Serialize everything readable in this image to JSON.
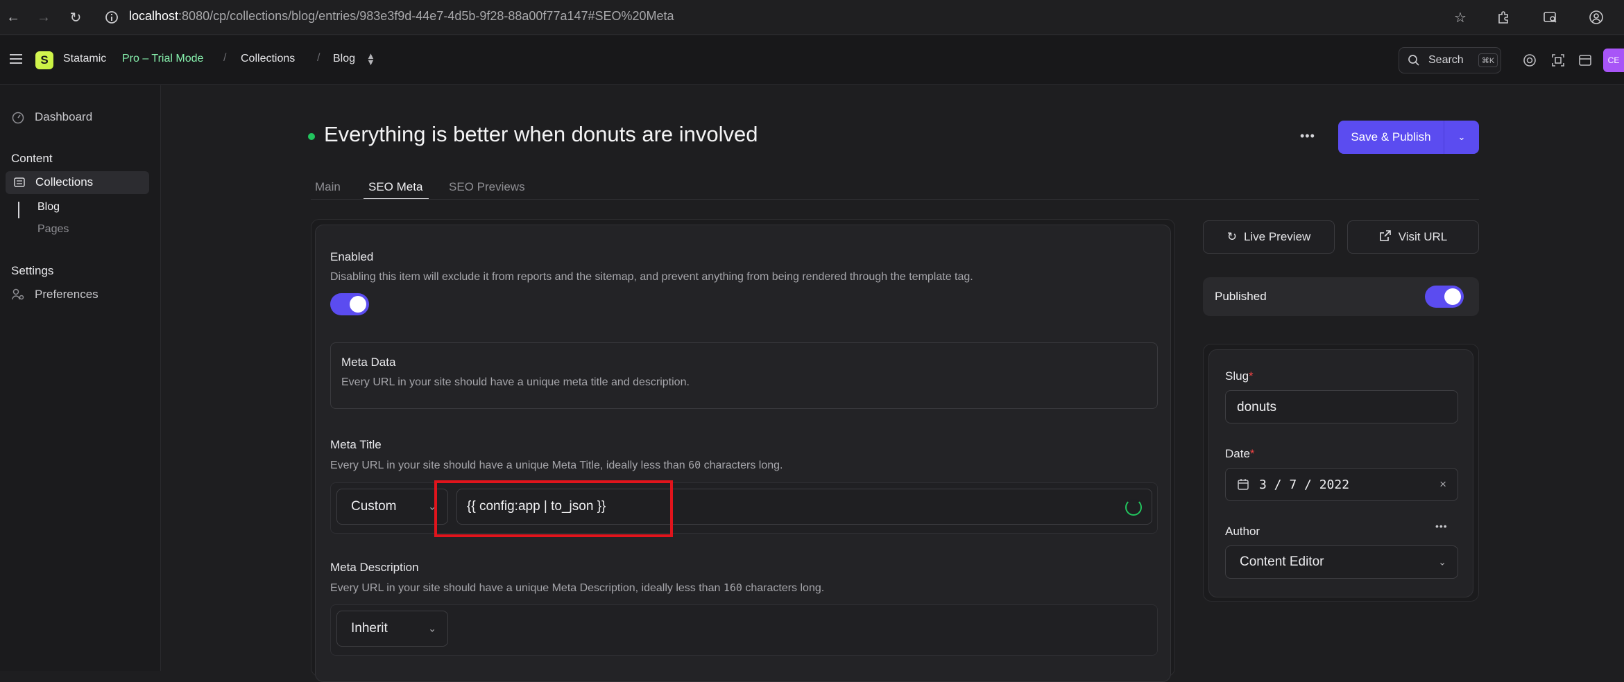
{
  "browser": {
    "url_host": "localhost",
    "url_path": ":8080/cp/collections/blog/entries/983e3f9d-44e7-4d5b-9f28-88a00f77a147#SEO%20Meta"
  },
  "header": {
    "app_name": "Statamic",
    "logo_letter": "S",
    "mode": "Pro – Trial Mode",
    "breadcrumb_sep": "/",
    "breadcrumb_collections": "Collections",
    "breadcrumb_blog": "Blog",
    "search_label": "Search",
    "search_shortcut": "⌘K",
    "avatar_initials": "CE"
  },
  "sidebar": {
    "dashboard": "Dashboard",
    "content_heading": "Content",
    "collections": "Collections",
    "blog": "Blog",
    "pages": "Pages",
    "settings_heading": "Settings",
    "preferences": "Preferences"
  },
  "entry": {
    "title": "Everything is better when donuts are involved",
    "status_color": "#22c55e",
    "more_label": "•••",
    "save_label": "Save & Publish"
  },
  "tabs": [
    {
      "label": "Main",
      "active": false
    },
    {
      "label": "SEO Meta",
      "active": true
    },
    {
      "label": "SEO Previews",
      "active": false
    }
  ],
  "seo": {
    "enabled_label": "Enabled",
    "enabled_help": "Disabling this item will exclude it from reports and the sitemap, and prevent anything from being rendered through the template tag.",
    "enabled": true,
    "meta_data_label": "Meta Data",
    "meta_data_help": "Every URL in your site should have a unique meta title and description.",
    "meta_title_label": "Meta Title",
    "meta_title_help_pre": "Every URL in your site should have a unique Meta Title, ideally less than ",
    "meta_title_help_num": "60",
    "meta_title_help_post": " characters long.",
    "meta_title_mode": "Custom",
    "meta_title_value": "{{ config:app | to_json }}",
    "meta_desc_label": "Meta Description",
    "meta_desc_help_pre": "Every URL in your site should have a unique Meta Description, ideally less than ",
    "meta_desc_help_num": "160",
    "meta_desc_help_post": " characters long.",
    "meta_desc_mode": "Inherit"
  },
  "side_panel": {
    "live_preview": "Live Preview",
    "visit_url": "Visit URL",
    "published_label": "Published",
    "published": true,
    "slug_label": "Slug",
    "slug_value": "donuts",
    "date_label": "Date",
    "date_value": "3 / 7 / 2022",
    "author_label": "Author",
    "author_value": "Content Editor",
    "required_mark": "*"
  },
  "colors": {
    "accent": "#5b4cf0",
    "highlight_box": "#e0141c",
    "trial_mode": "#86efac"
  }
}
